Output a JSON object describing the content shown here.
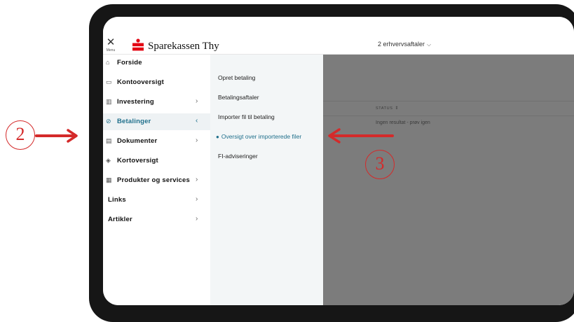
{
  "app": {
    "menu_label": "Menu",
    "brand": "Sparekassen Thy",
    "agreement_label": "2 erhvervsaftaler",
    "agreement_chevron": "⌵",
    "brand_color": "#e30613",
    "accent_color": "#1f6f8b"
  },
  "nav": {
    "items": [
      {
        "label": "Forside",
        "icon": "house-icon",
        "glyph": "⌂",
        "arrow": ""
      },
      {
        "label": "Kontooversigt",
        "icon": "wallet-icon",
        "glyph": "▭",
        "arrow": ""
      },
      {
        "label": "Investering",
        "icon": "chart-icon",
        "glyph": "▥",
        "arrow": "›"
      },
      {
        "label": "Betalinger",
        "icon": "payment-icon",
        "glyph": "⊘",
        "arrow": "‹",
        "active": true
      },
      {
        "label": "Dokumenter",
        "icon": "document-icon",
        "glyph": "▤",
        "arrow": "›"
      },
      {
        "label": "Kortoversigt",
        "icon": "card-icon",
        "glyph": "◈",
        "arrow": ""
      },
      {
        "label": "Produkter og services",
        "icon": "products-icon",
        "glyph": "▦",
        "arrow": "›"
      },
      {
        "label": "Links",
        "icon": "",
        "glyph": "",
        "arrow": "›"
      },
      {
        "label": "Artikler",
        "icon": "",
        "glyph": "",
        "arrow": "›"
      }
    ]
  },
  "submenu": {
    "items": [
      {
        "label": "Opret betaling"
      },
      {
        "label": "Betalingsaftaler"
      },
      {
        "label": "Importer fil til betaling"
      },
      {
        "label": "Oversigt over importerede filer",
        "active": true
      },
      {
        "label": "FI-adviseringer"
      }
    ]
  },
  "content": {
    "column_header": "STATUS",
    "sort_glyph": "⇕",
    "empty_message": "Ingen resultat - prøv igen"
  },
  "annotations": {
    "callout_left": "2",
    "callout_right": "3",
    "color": "#d42a2a"
  }
}
